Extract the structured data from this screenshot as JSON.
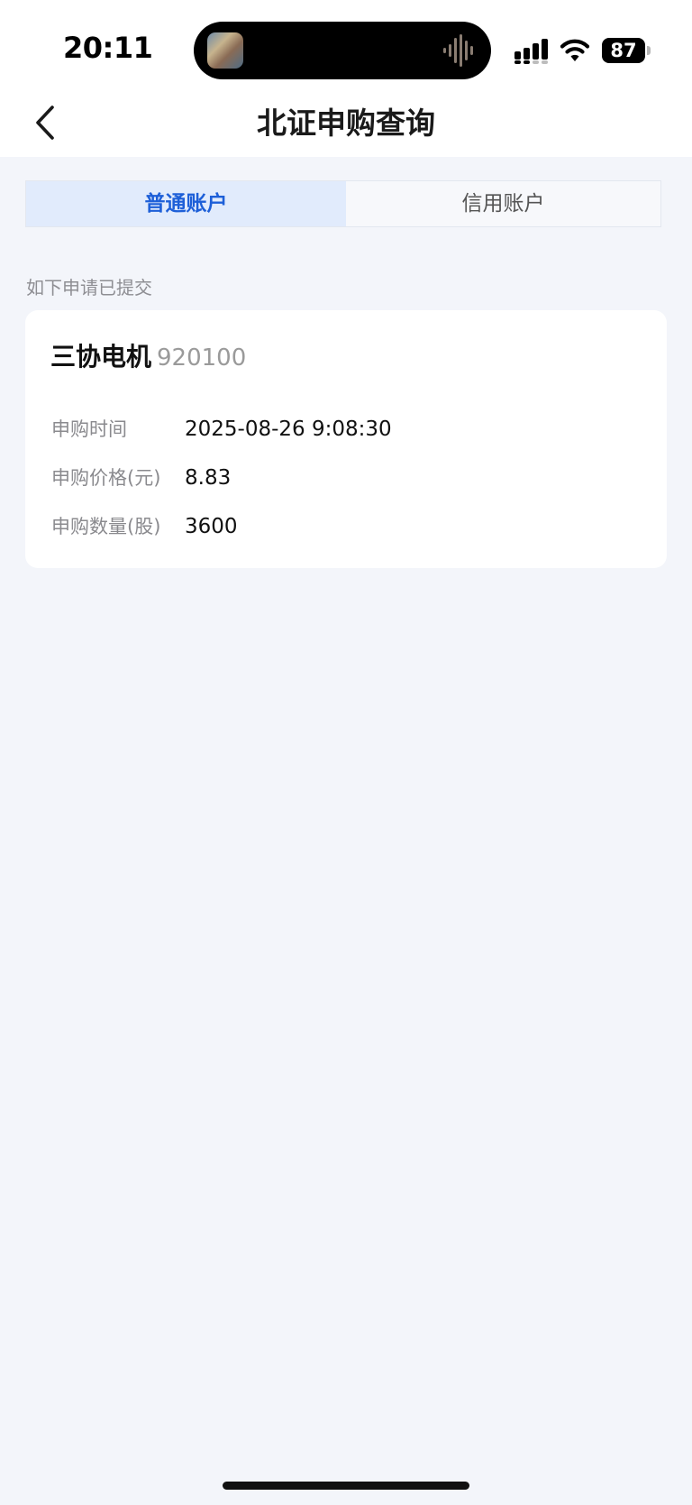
{
  "status_bar": {
    "time": "20:11",
    "battery": "87"
  },
  "nav": {
    "title": "北证申购查询"
  },
  "tabs": [
    {
      "label": "普通账户",
      "active": true
    },
    {
      "label": "信用账户",
      "active": false
    }
  ],
  "section": {
    "hint": "如下申请已提交"
  },
  "subscription": {
    "stock_name": "三协电机",
    "stock_code": "920100",
    "rows": [
      {
        "label": "申购时间",
        "value": "2025-08-26 9:08:30"
      },
      {
        "label": "申购价格(元)",
        "value": "8.83"
      },
      {
        "label": "申购数量(股)",
        "value": "3600"
      }
    ]
  },
  "colors": {
    "accent": "#1d5fd8",
    "active_tab_bg": "#e1ebfc",
    "page_bg": "#f3f5fa"
  },
  "icons": {
    "back": "chevron-left-icon",
    "signal": "cellular-signal-icon",
    "wifi": "wifi-icon",
    "battery": "battery-icon",
    "audio": "audio-waveform-icon"
  }
}
